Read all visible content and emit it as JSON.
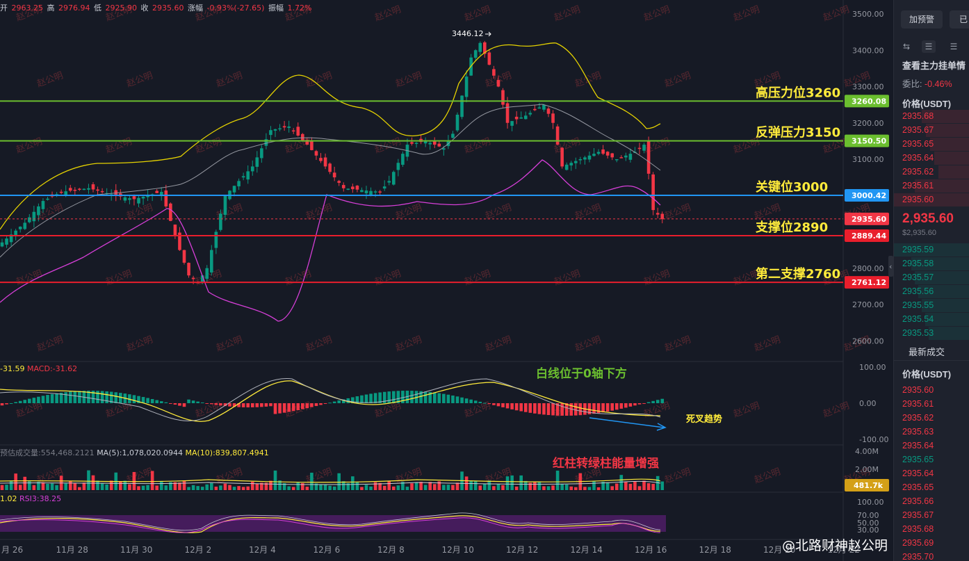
{
  "hud": {
    "open_label": "开",
    "open": "2963.25",
    "high_label": "高",
    "high": "2976.94",
    "low_label": "低",
    "low": "2925.90",
    "close_label": "收",
    "close": "2935.60",
    "change_label": "涨幅",
    "change": "-0.93%(-27.65)",
    "amp_label": "振幅",
    "amp": "1.72%"
  },
  "watermark": "赵公明",
  "annotations": {
    "level_3260": "高压力位3260",
    "level_3150": "反弹压力3150",
    "level_3000": "关键位3000",
    "level_2890": "支撑位2890",
    "level_2760": "第二支撑2760",
    "macd_note": "白线位于0轴下方",
    "cross_note": "死叉趋势",
    "volume_note": "红柱转绿柱能量增强",
    "peak_label": "3446.12"
  },
  "price_axis": [
    "3500.00",
    "3400.00",
    "3300.00",
    "3200.00",
    "3100.00",
    "2800.00",
    "2700.00",
    "2600.00"
  ],
  "price_tags": {
    "t3260": "3260.08",
    "t3150": "3150.50",
    "t3000": "3000.42",
    "tlast": "2935.60",
    "t2890": "2889.44",
    "t2760": "2761.12"
  },
  "colors": {
    "up": "#089981",
    "down": "#f23645",
    "green_line": "#6bbe2f",
    "blue_line": "#2196f3",
    "red_line": "#e91e2c",
    "annotation": "#ffeb3b",
    "boll_upper": "#e6d300",
    "boll_mid": "#9598a1",
    "boll_lower": "#d63fd8"
  },
  "macd": {
    "prefix": "-31.59",
    "label": "MACD:-31.62",
    "axis": [
      "100.00",
      "0.00",
      "-100.00"
    ]
  },
  "volume": {
    "label_trunc": "预估成交量:554,468.2121",
    "ma5": "MA(5):1,078,020.0944",
    "ma10": "MA(10):839,807.4941",
    "axis": [
      "4.00M",
      "2.00M"
    ],
    "tag": "481.7k"
  },
  "rsi": {
    "prefix": "1.02",
    "label": "RSI3:38.25",
    "axis": [
      "100.00",
      "70.00",
      "50.00",
      "30.00"
    ]
  },
  "x_axis": [
    "月 26",
    "11月 28",
    "11月 30",
    "12月 2",
    "12月 4",
    "12月 6",
    "12月 8",
    "12月 10",
    "12月 12",
    "12月 14",
    "12月 16",
    "12月 18",
    "12月 20",
    "12月 22"
  ],
  "orderbook": {
    "alert_button": "加预警",
    "btn2": "已",
    "view_main": "查看主力挂单情",
    "ratio_label": "委比:",
    "ratio_value": "-0.46%",
    "price_header": "价格(USDT)",
    "asks": [
      "2935.68",
      "2935.67",
      "2935.65",
      "2935.64",
      "2935.62",
      "2935.61",
      "2935.60"
    ],
    "last_price": "2,935.60",
    "last_usd": "$2,935.60",
    "bids": [
      "2935.59",
      "2935.58",
      "2935.57",
      "2935.56",
      "2935.55",
      "2935.54",
      "2935.53"
    ],
    "trades_title": "最新成交",
    "trades_header": "价格(USDT)",
    "trades": [
      {
        "p": "2935.60",
        "side": "down"
      },
      {
        "p": "2935.61",
        "side": "down"
      },
      {
        "p": "2935.62",
        "side": "down"
      },
      {
        "p": "2935.63",
        "side": "down"
      },
      {
        "p": "2935.64",
        "side": "down"
      },
      {
        "p": "2935.65",
        "side": "up"
      },
      {
        "p": "2935.64",
        "side": "down"
      },
      {
        "p": "2935.65",
        "side": "down"
      },
      {
        "p": "2935.66",
        "side": "down"
      },
      {
        "p": "2935.67",
        "side": "down"
      },
      {
        "p": "2935.68",
        "side": "down"
      },
      {
        "p": "2935.69",
        "side": "down"
      },
      {
        "p": "2935.70",
        "side": "down"
      }
    ]
  },
  "footer_watermark": "@北路财神赵公明"
}
